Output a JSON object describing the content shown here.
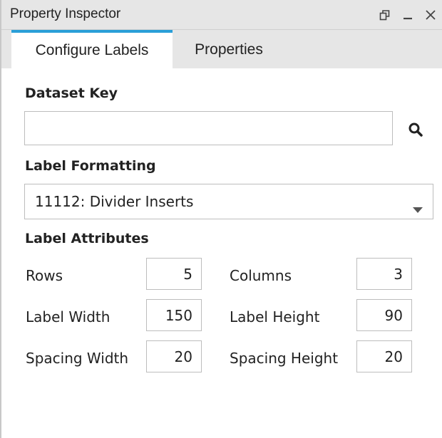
{
  "window": {
    "title": "Property Inspector",
    "controls": [
      "restore-icon",
      "minimize-icon",
      "close-icon"
    ]
  },
  "tabs": [
    {
      "label": "Configure Labels",
      "active": true
    },
    {
      "label": "Properties",
      "active": false
    }
  ],
  "dataset_key": {
    "label": "Dataset Key",
    "value": "",
    "placeholder": "",
    "search_icon": "search-icon"
  },
  "label_formatting": {
    "label": "Label Formatting",
    "selected": "11112: Divider Inserts",
    "caret_icon": "caret-down-icon"
  },
  "label_attributes": {
    "label": "Label Attributes",
    "rows": {
      "label": "Rows",
      "value": "5"
    },
    "columns": {
      "label": "Columns",
      "value": "3"
    },
    "label_width": {
      "label": "Label Width",
      "value": "150"
    },
    "label_height": {
      "label": "Label Height",
      "value": "90"
    },
    "spacing_width": {
      "label": "Spacing Width",
      "value": "20"
    },
    "spacing_height": {
      "label": "Spacing Height",
      "value": "20"
    }
  },
  "colors": {
    "active_tab_accent": "#2a9fd8",
    "header_background": "#e6e6e6"
  }
}
